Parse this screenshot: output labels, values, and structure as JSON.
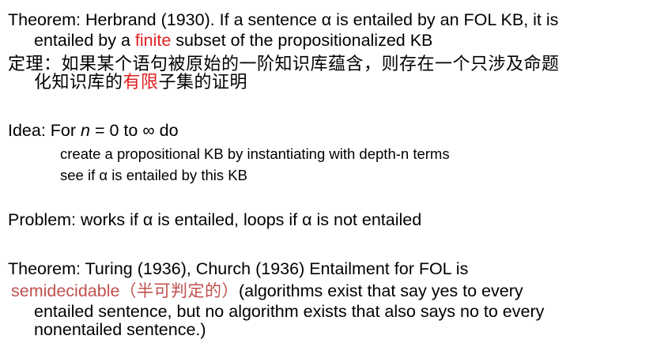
{
  "theorem1": {
    "line1": "Theorem: Herbrand (1930). If a sentence α is entailed by an FOL KB, it is",
    "line2_pre": "entailed by a ",
    "line2_highlight": "finite",
    "line2_post": " subset of the propositionalized KB",
    "cn_line1": "定理：如果某个语句被原始的一阶知识库蕴含，则存在一个只涉及命题",
    "cn_line2_pre": "化知识库的",
    "cn_line2_highlight": "有限",
    "cn_line2_post": "子集的证明"
  },
  "idea": {
    "pre": "Idea: For ",
    "var": "n",
    "post": " = 0 to ∞ do",
    "step1": "create a propositional KB by instantiating with depth-n terms",
    "step2": "see if α is entailed by this KB"
  },
  "problem": {
    "text": "Problem: works if α is entailed, loops if α is not entailed"
  },
  "theorem2": {
    "line1": "Theorem: Turing (1936), Church (1936) Entailment for FOL is",
    "line2_highlight": "semidecidable",
    "line2_cn": "（半可判定的）",
    "line2_post": "(algorithms exist that say yes to every",
    "line3": "entailed sentence, but no algorithm exists that also says no to every",
    "line4": "nonentailed sentence.)"
  },
  "colors": {
    "highlight_red": "#e02020",
    "highlight_rose": "#c0504d",
    "text": "#000000",
    "background": "#ffffff"
  }
}
